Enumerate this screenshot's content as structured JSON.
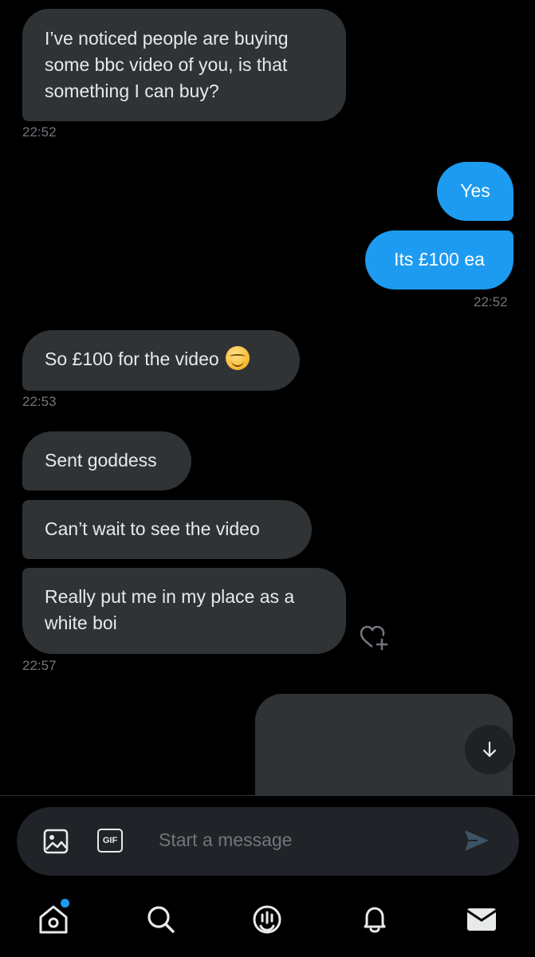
{
  "messages": [
    {
      "text": "I’ve noticed people are buying some bbc video of you, is that something I can buy?",
      "time": "22:52"
    },
    {
      "text": "Yes"
    },
    {
      "text": "Its £100 ea",
      "time": "22:52"
    },
    {
      "text": "So £100 for the video",
      "time": "22:53"
    },
    {
      "text": "Sent goddess"
    },
    {
      "text": "Can’t wait to see the video"
    },
    {
      "text": "Really put me in my place as a white boi",
      "time": "22:57"
    }
  ],
  "composer": {
    "placeholder": "Start a message",
    "gif_label": "GIF"
  },
  "colors": {
    "accent": "#1d9bf0",
    "bubble_in": "#2f3336",
    "background": "#000000"
  },
  "icons": {
    "react": "heart-plus-icon",
    "scroll": "arrow-down-icon",
    "media": "image-icon",
    "gif": "gif-icon",
    "send": "send-icon",
    "nav": [
      "home-icon",
      "search-icon",
      "spaces-icon",
      "bell-icon",
      "mail-icon"
    ]
  }
}
